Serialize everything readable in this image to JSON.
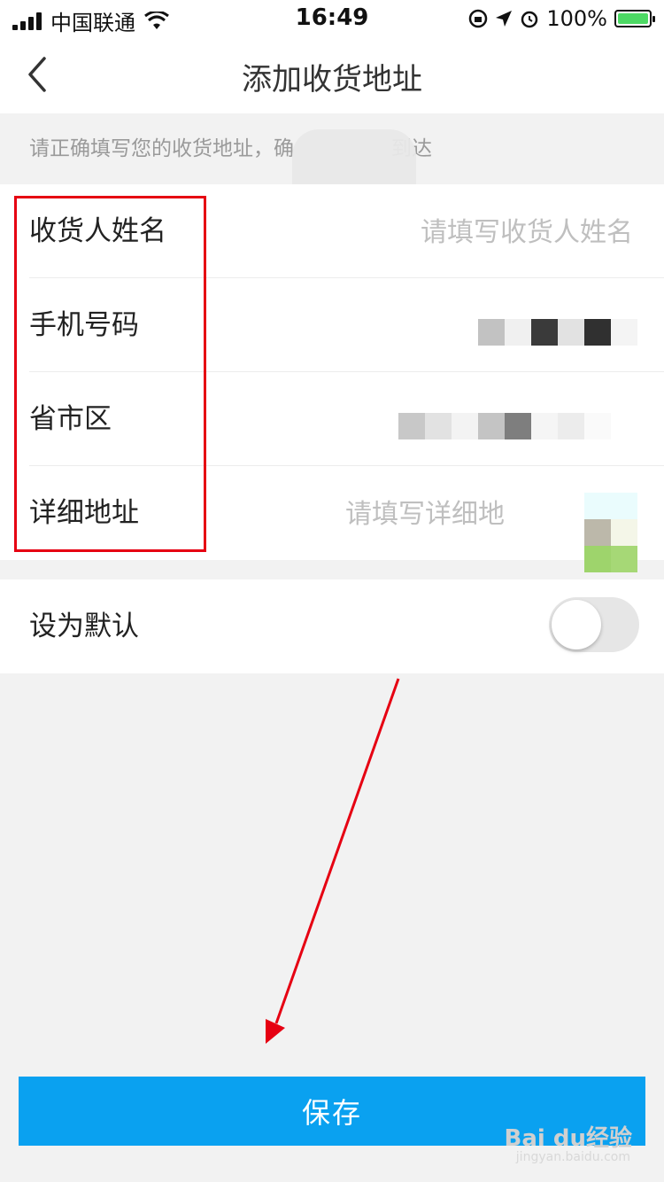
{
  "status_bar": {
    "carrier": "中国联通",
    "time": "16:49",
    "battery_percent": "100%"
  },
  "nav": {
    "title": "添加收货地址"
  },
  "notice": {
    "text": "请正确填写您的收货地址，确",
    "text_tail": "到达"
  },
  "form": {
    "rows": [
      {
        "label": "收货人姓名",
        "placeholder": "请填写收货人姓名"
      },
      {
        "label": "手机号码"
      },
      {
        "label": "省市区"
      },
      {
        "label": "详细地址",
        "placeholder": "请填写详细地"
      }
    ]
  },
  "default_setting": {
    "label": "设为默认",
    "enabled": false
  },
  "save_button": {
    "label": "保存"
  },
  "watermark": {
    "brand": "Bai du经验",
    "url": "jingyan.baidu.com"
  },
  "colors": {
    "accent": "#0aa1f0",
    "highlight": "#e60012"
  }
}
